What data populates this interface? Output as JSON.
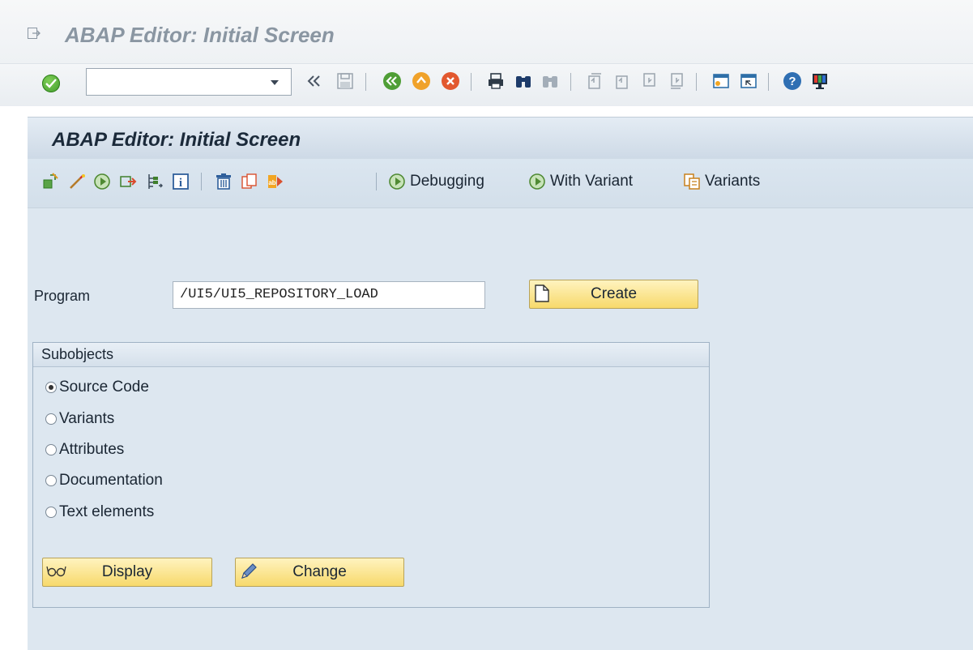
{
  "window": {
    "title": "ABAP Editor: Initial Screen"
  },
  "system_toolbar": {
    "command_field_value": "",
    "icons": [
      "enter-icon",
      "command-dropdown-icon",
      "collapse-icon",
      "save-icon",
      "back-icon",
      "exit-icon",
      "cancel-icon",
      "print-icon",
      "find-icon",
      "find-next-icon",
      "first-page-icon",
      "previous-page-icon",
      "next-page-icon",
      "last-page-icon",
      "new-session-icon",
      "shortcut-icon",
      "help-icon",
      "customize-layout-icon"
    ]
  },
  "app": {
    "title": "ABAP Editor: Initial Screen",
    "toolbar": {
      "icons": [
        "other-object-icon",
        "check-icon",
        "activate-icon",
        "test-icon",
        "where-used-icon",
        "info-icon",
        "delete-icon",
        "copy-icon",
        "rename-icon"
      ],
      "debugging_label": "Debugging",
      "with_variant_label": "With Variant",
      "variants_label": "Variants"
    }
  },
  "form": {
    "program_label": "Program",
    "program_value": "/UI5/UI5_REPOSITORY_LOAD",
    "create_label": "Create"
  },
  "subobjects": {
    "heading": "Subobjects",
    "options": [
      {
        "label": "Source Code",
        "checked": true
      },
      {
        "label": "Variants",
        "checked": false
      },
      {
        "label": "Attributes",
        "checked": false
      },
      {
        "label": "Documentation",
        "checked": false
      },
      {
        "label": "Text elements",
        "checked": false
      }
    ],
    "display_label": "Display",
    "change_label": "Change"
  },
  "colors": {
    "button_fill": "#f7d96b",
    "main_background": "#dde7f0",
    "title_text": "#8a96a2"
  }
}
